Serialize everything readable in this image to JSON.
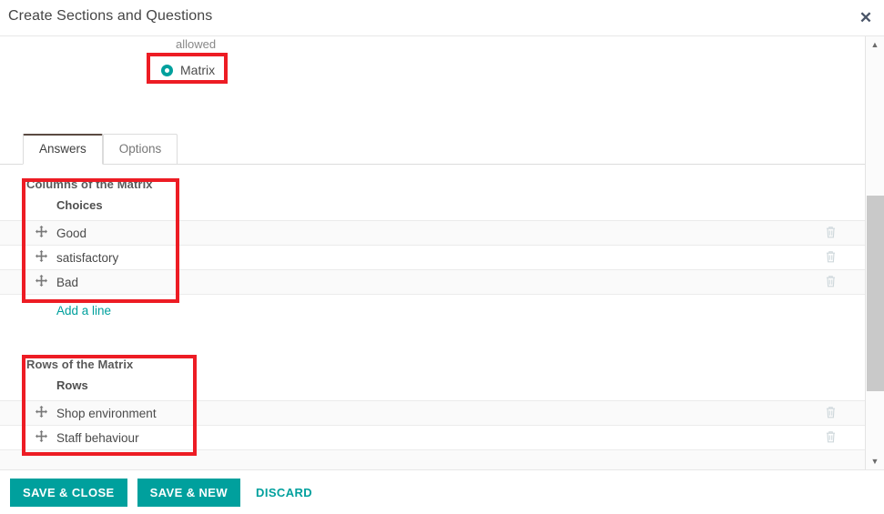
{
  "dialog": {
    "title": "Create Sections and Questions",
    "close_icon": "close-icon",
    "close_label": "✕"
  },
  "question_type": {
    "partial_text_above": "allowed",
    "selected_option": "Matrix",
    "radio_icon": "radio-selected-icon"
  },
  "tabs": [
    {
      "label": "Answers",
      "active": true
    },
    {
      "label": "Options",
      "active": false
    }
  ],
  "columns_section": {
    "title": "Columns of the Matrix",
    "column_header": "Choices",
    "rows": [
      {
        "handle_icon": "move-icon",
        "label": "Good",
        "delete_icon": "trash-icon"
      },
      {
        "handle_icon": "move-icon",
        "label": "satisfactory",
        "delete_icon": "trash-icon"
      },
      {
        "handle_icon": "move-icon",
        "label": "Bad",
        "delete_icon": "trash-icon"
      }
    ],
    "add_line_label": "Add a line"
  },
  "rows_section": {
    "title": "Rows of the Matrix",
    "column_header": "Rows",
    "rows": [
      {
        "handle_icon": "move-icon",
        "label": "Shop environment",
        "delete_icon": "trash-icon"
      },
      {
        "handle_icon": "move-icon",
        "label": "Staff behaviour",
        "delete_icon": "trash-icon"
      }
    ]
  },
  "scrollbar": {
    "up_arrow": "▲",
    "down_arrow": "▼"
  },
  "footer": {
    "save_close_label": "SAVE & CLOSE",
    "save_new_label": "SAVE & NEW",
    "discard_label": "DISCARD"
  },
  "colors": {
    "accent_teal": "#00A09D",
    "highlight_red": "#ed1c24",
    "row_stripe": "#fafafa",
    "border": "#ebebeb"
  },
  "annotations": [
    {
      "name": "matrix-option-highlight"
    },
    {
      "name": "columns-of-matrix-highlight"
    },
    {
      "name": "rows-of-matrix-highlight"
    }
  ]
}
